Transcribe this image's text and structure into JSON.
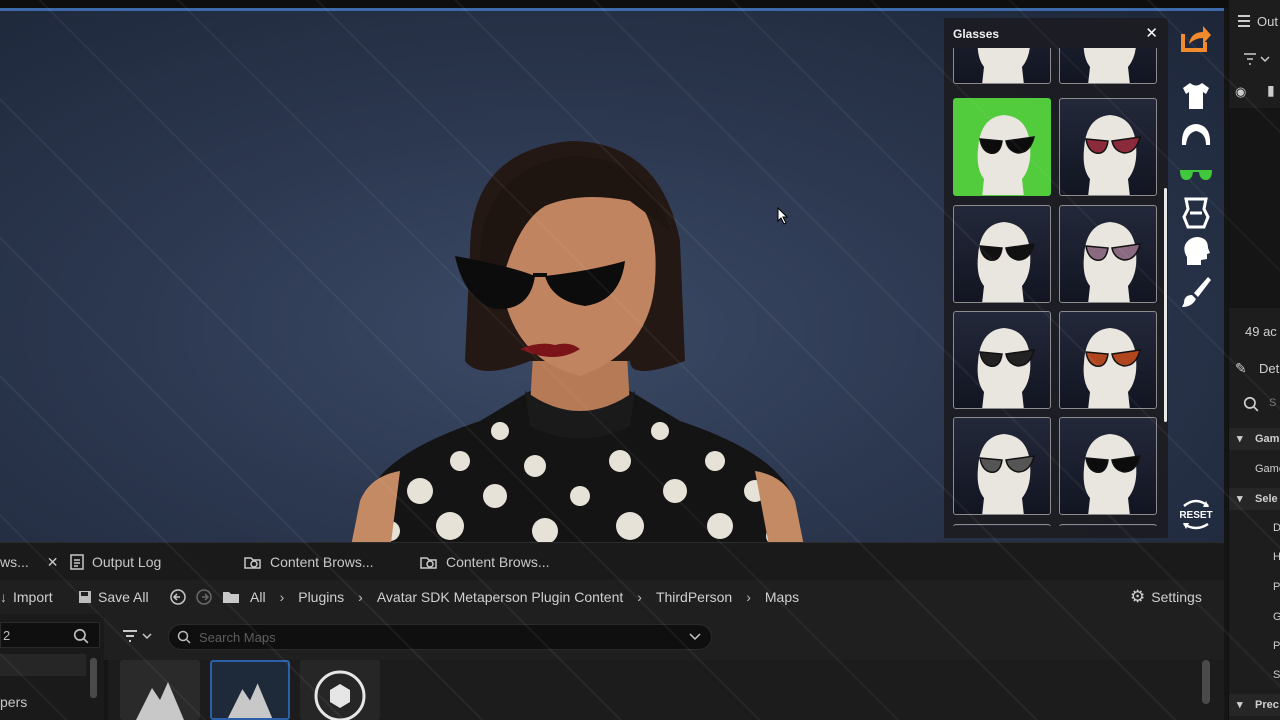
{
  "glasses_panel": {
    "title": "Glasses",
    "close_icon": "close-icon",
    "selected_index": 0,
    "accent_color": "#52cc3c"
  },
  "toolbar": {
    "icons": [
      "share-export-icon",
      "shirt-icon",
      "hair-icon",
      "glasses-icon",
      "body-icon",
      "head-icon",
      "brush-icon"
    ],
    "reset_label": "RESET"
  },
  "tabs": [
    {
      "label": "ws...",
      "icon": "close-icon"
    },
    {
      "label": "Output Log",
      "icon": "log-icon"
    },
    {
      "label": "Content Brows...",
      "icon": "content-browser-icon"
    },
    {
      "label": "Content Brows...",
      "icon": "content-browser-icon"
    }
  ],
  "content_toolbar": {
    "import_label": "Import",
    "save_all_label": "Save All",
    "breadcrumbs": [
      "All",
      "Plugins",
      "Avatar SDK Metaperson Plugin Content",
      "ThirdPerson",
      "Maps"
    ],
    "settings_label": "Settings"
  },
  "filter_bar": {
    "search_placeholder": "Search Maps"
  },
  "left_pane": {
    "count_text": "2",
    "label": "pers"
  },
  "right_panel": {
    "outliner_label": "Out",
    "actors_text": "49 ac",
    "details_label": "Det",
    "search_text": "S",
    "section1": "Game",
    "row1": "Game",
    "section2": "Sele",
    "rows": [
      "D",
      "H",
      "Pl",
      "G",
      "Pl",
      "Sj"
    ],
    "section3": "Prec"
  }
}
